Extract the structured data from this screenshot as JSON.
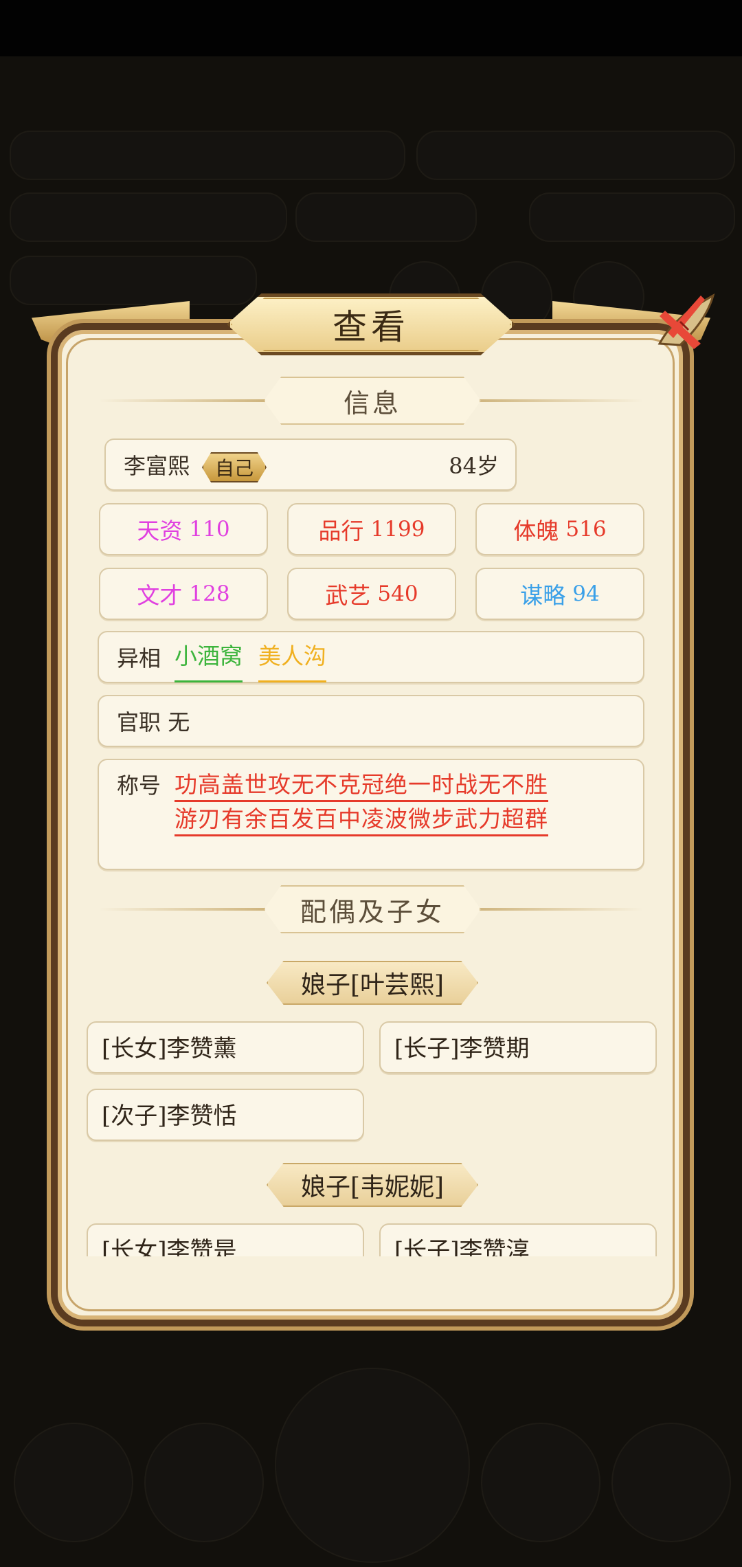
{
  "dialog": {
    "title": "查看",
    "close_icon": "close-x-icon"
  },
  "info": {
    "section_title": "信息",
    "name": "李富熙",
    "self_tag": "自己",
    "age": "84岁",
    "stats": [
      {
        "label": "天资",
        "value": "110",
        "color": "#e040e0"
      },
      {
        "label": "品行",
        "value": "1199",
        "color": "#e63a2a"
      },
      {
        "label": "体魄",
        "value": "516",
        "color": "#e63a2a"
      },
      {
        "label": "文才",
        "value": "128",
        "color": "#e040e0"
      },
      {
        "label": "武艺",
        "value": "540",
        "color": "#e63a2a"
      },
      {
        "label": "谋略",
        "value": "94",
        "color": "#3aa0e8"
      }
    ],
    "appearance_label": "异相",
    "appearance": [
      {
        "text": "小酒窝",
        "color": "#3cb43c"
      },
      {
        "text": "美人沟",
        "color": "#f0b020"
      }
    ],
    "office_label": "官职",
    "office_value": "无",
    "titles_label": "称号",
    "titles_line1": "功高盖世攻无不克冠绝一时战无不胜",
    "titles_line2": "游刃有余百发百中凌波微步武力超群"
  },
  "family": {
    "section_title": "配偶及子女",
    "spouses": [
      {
        "label": "娘子[叶芸熙]",
        "children": [
          "[长女]李赞薰",
          "[长子]李赞期",
          "[次子]李赞恬"
        ]
      },
      {
        "label": "娘子[韦妮妮]",
        "children": [
          "[长女]李赞是",
          "[长子]李赞淳"
        ]
      }
    ]
  }
}
